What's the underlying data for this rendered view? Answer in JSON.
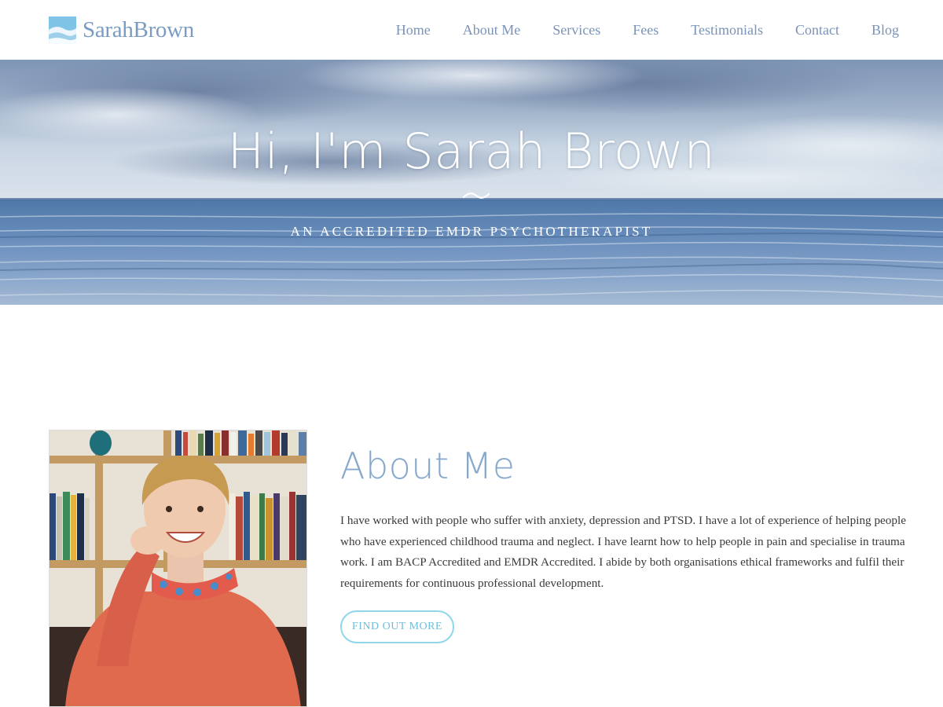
{
  "brand": {
    "name": "SarahBrown",
    "icon": "waves-logo-icon",
    "color": "#7a9cc4"
  },
  "nav": {
    "items": [
      {
        "label": "Home"
      },
      {
        "label": "About Me"
      },
      {
        "label": "Services"
      },
      {
        "label": "Fees"
      },
      {
        "label": "Testimonials"
      },
      {
        "label": "Contact"
      },
      {
        "label": "Blog"
      }
    ]
  },
  "hero": {
    "title": "Hi, I'm Sarah Brown",
    "subtitle": "An Accredited EMDR Psychotherapist",
    "divider_icon": "wave-divider-icon",
    "background": "sea-and-sky-image"
  },
  "about": {
    "title": "About Me",
    "body": "I have worked with people who suffer with anxiety, depression and PTSD. I have a lot of experience of helping people who have experienced childhood trauma and neglect. I have learnt how to help people in pain and specialise in trauma work. I am BACP Accredited and EMDR Accredited. I abide by both organisations ethical frameworks and fulfil their requirements for continuous professional development.",
    "button_label": "Find out more",
    "photo": "portrait-photo"
  },
  "colors": {
    "accent": "#86a8cc",
    "button_border": "#8fd6ea",
    "nav": "#7a93b8"
  }
}
